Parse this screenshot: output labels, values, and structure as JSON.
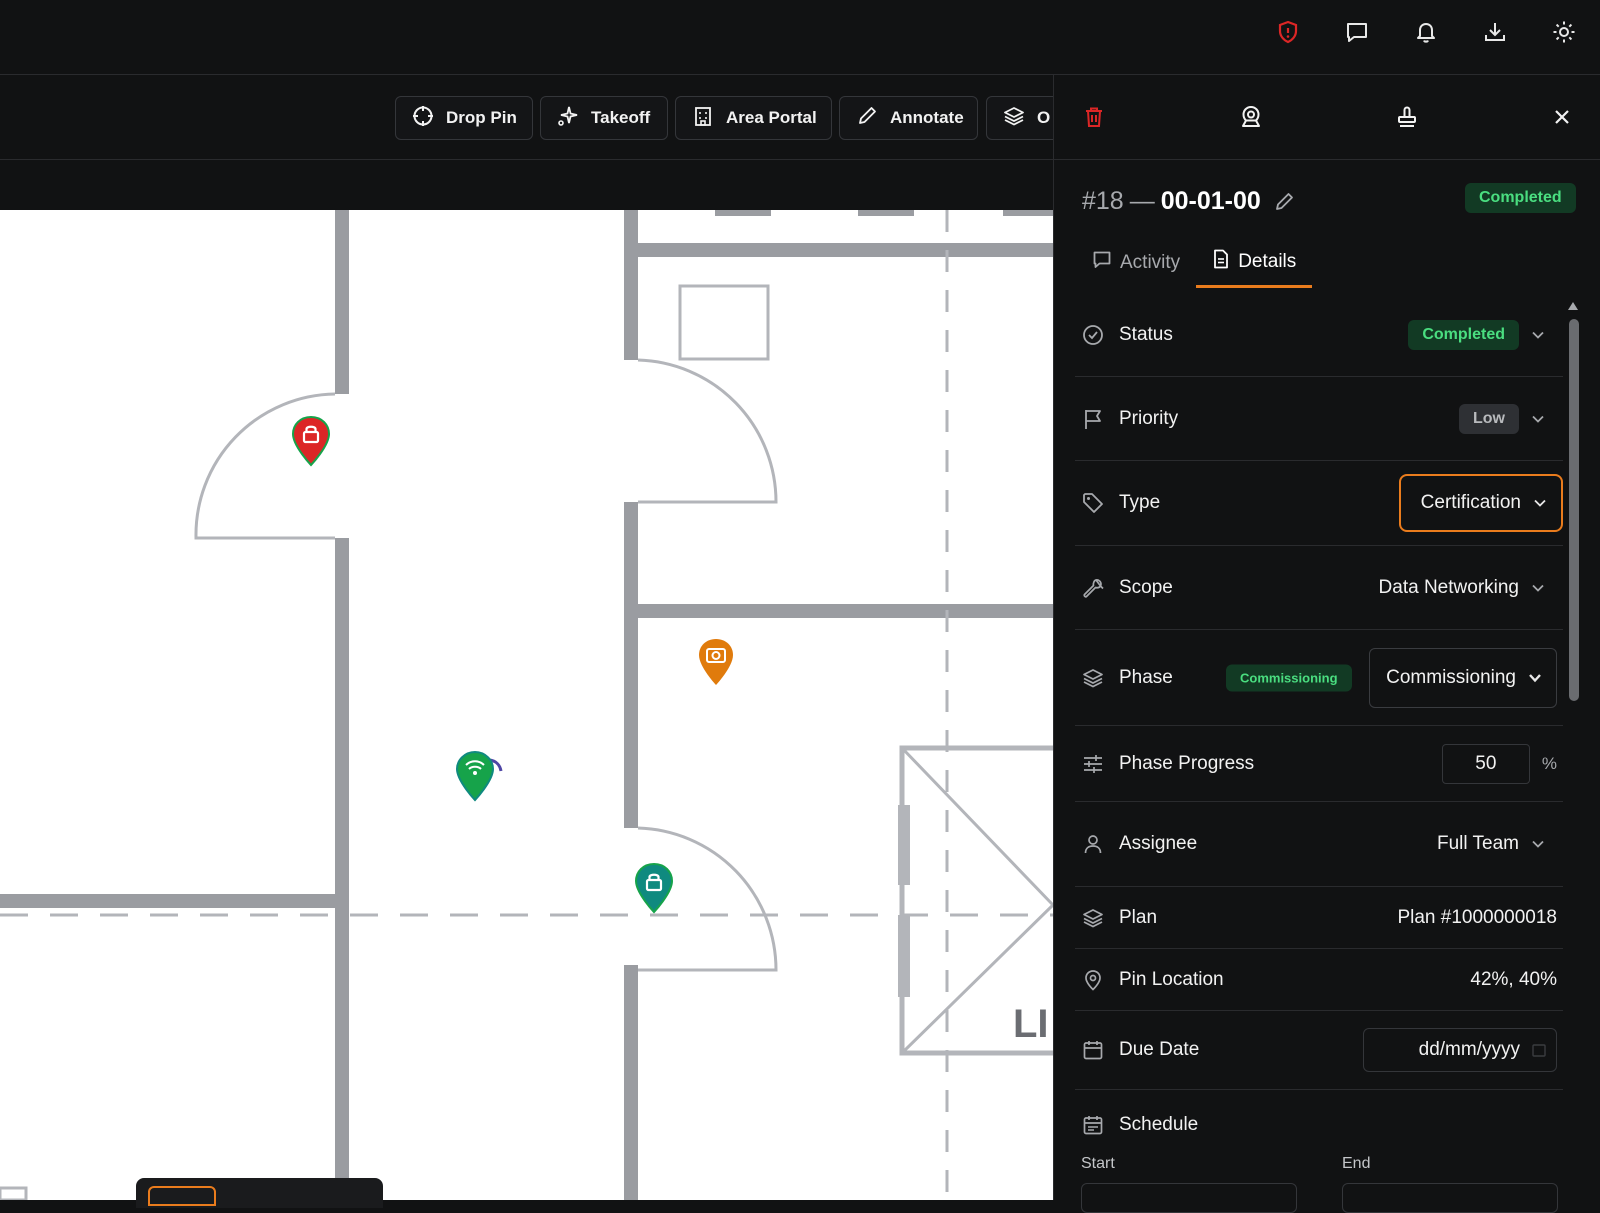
{
  "toolbar": {
    "drop_pin": "Drop Pin",
    "takeoff": "Takeoff",
    "area_portal": "Area Portal",
    "annotate": "Annotate",
    "overflow": "O"
  },
  "detail": {
    "number": "#18",
    "separator": "—",
    "code": "00-01-00",
    "status_badge": "Completed",
    "tabs": {
      "activity": "Activity",
      "details": "Details"
    },
    "rows": {
      "status": {
        "label": "Status",
        "value": "Completed"
      },
      "priority": {
        "label": "Priority",
        "value": "Low"
      },
      "type": {
        "label": "Type",
        "value": "Certification"
      },
      "scope": {
        "label": "Scope",
        "value": "Data Networking"
      },
      "phase": {
        "label": "Phase",
        "badge": "Commissioning",
        "value": "Commissioning"
      },
      "phase_progress": {
        "label": "Phase Progress",
        "value": "50",
        "unit": "%"
      },
      "assignee": {
        "label": "Assignee",
        "value": "Full Team"
      },
      "plan": {
        "label": "Plan",
        "value": "Plan #1000000018"
      },
      "pin_location": {
        "label": "Pin Location",
        "value": "42%, 40%"
      },
      "due_date": {
        "label": "Due Date",
        "placeholder": "dd/mm/yyyy"
      },
      "schedule": {
        "label": "Schedule",
        "start": "Start",
        "end": "End"
      }
    }
  },
  "plan_text": "LI",
  "colors": {
    "accent": "#ea7c1d",
    "success": "#4ade80",
    "danger": "#dc2626",
    "pin_red": "#dc2626",
    "pin_orange": "#e07b0c",
    "pin_green": "#16a34a",
    "pin_teal": "#0f8a7f"
  },
  "icons": {
    "top": [
      "shield-alert-icon",
      "chat-icon",
      "bell-icon",
      "download-icon",
      "sun-icon"
    ],
    "panel": [
      "trash-icon",
      "user-pin-icon",
      "stamp-icon",
      "close-icon"
    ]
  }
}
